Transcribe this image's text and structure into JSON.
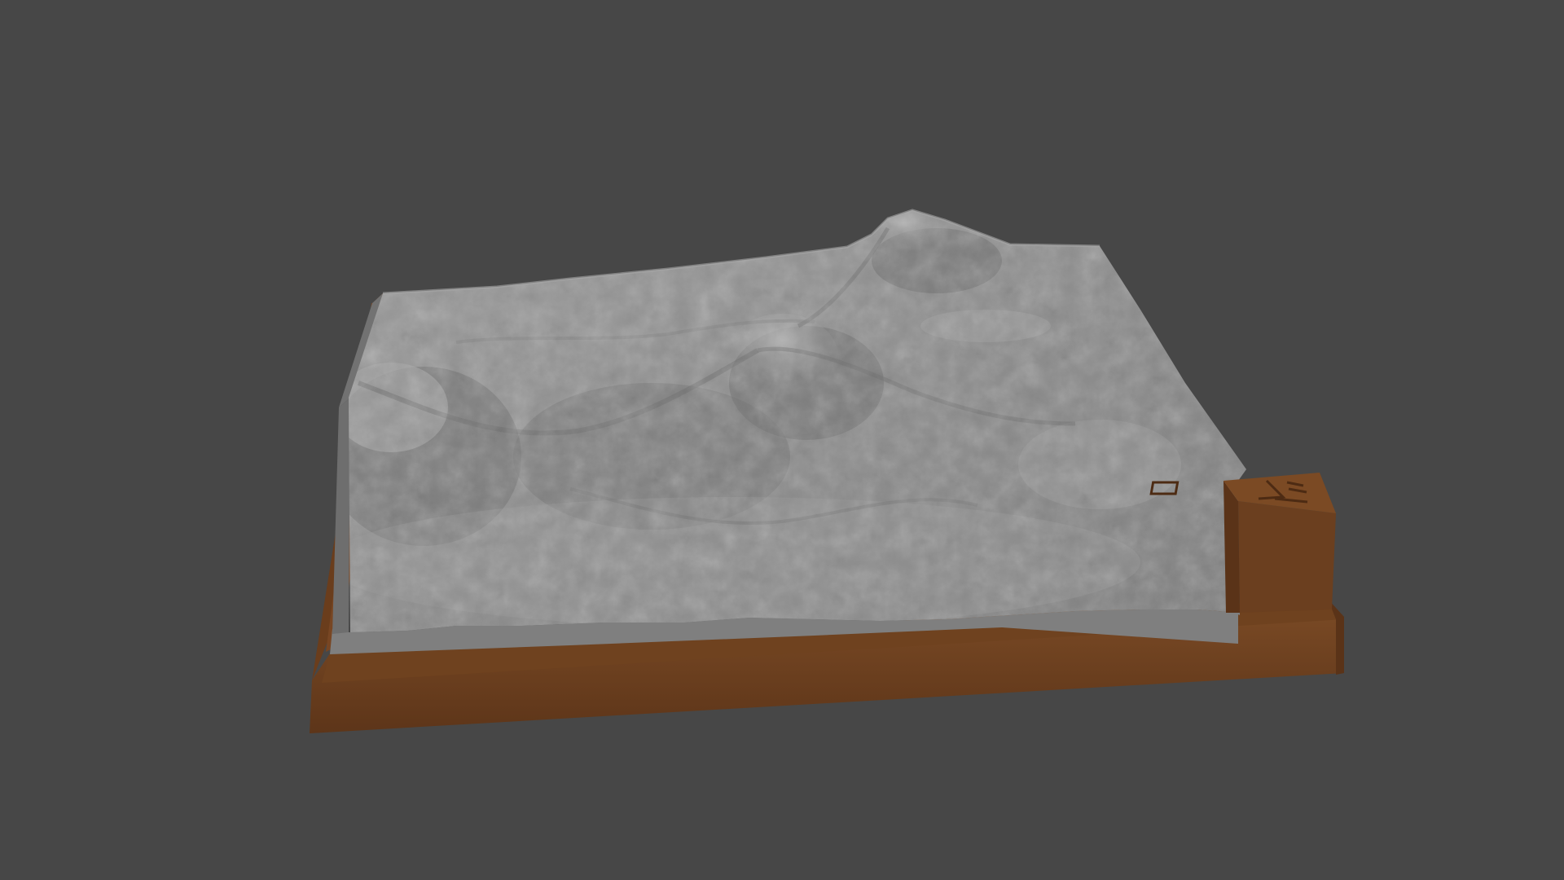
{
  "scene": {
    "background_color": "#474747",
    "object": "terrain-relief-model",
    "colors": {
      "terrain": "#8c8c8c",
      "terrain_shadow": "#626262",
      "terrain_highlight": "#b3b3b3",
      "base": "#6b3f1f",
      "base_dark": "#54311a",
      "base_light": "#7a4a25",
      "inner_edge": "#7b7b7b"
    }
  }
}
